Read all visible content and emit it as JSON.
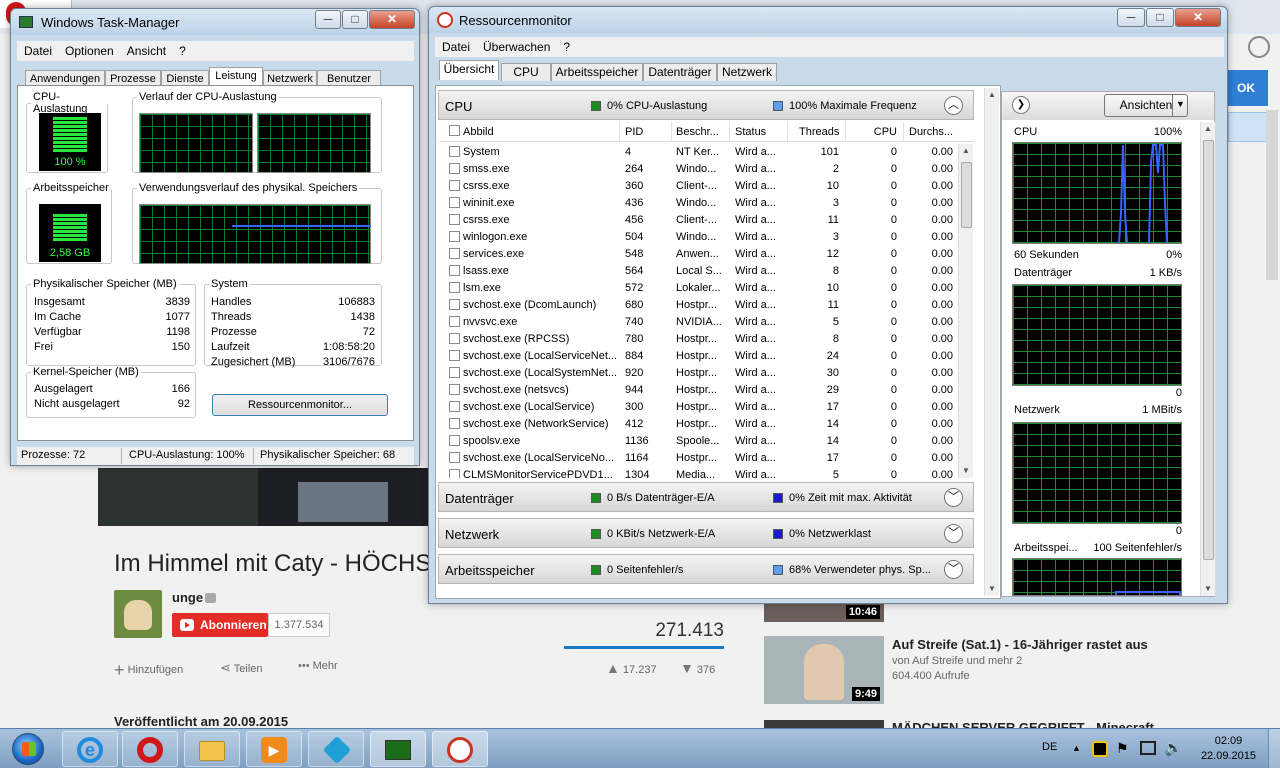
{
  "background": {
    "browser_tab": "Opera",
    "blue_button": "OK",
    "video_title": "Im Himmel mit Caty - HÖCHST",
    "channel": "unge",
    "subscribe": "Abonnieren",
    "subscribers": "1.377.534",
    "views": "271.413",
    "add": "Hinzufügen",
    "share": "Teilen",
    "more": "Mehr",
    "likes": "17.237",
    "dislikes": "376",
    "published": "Veröffentlicht am 20.09.2015",
    "related": [
      {
        "duration": "10:46"
      },
      {
        "title": "Auf Streife (Sat.1) - 16-Jähriger rastet aus",
        "channel": "von Auf Streife und mehr 2",
        "views": "604.400 Aufrufe",
        "duration": "9:49"
      },
      {
        "title": "MÄDCHEN SERVER GEGRIFFT - Minecraft"
      }
    ]
  },
  "taskmgr": {
    "title": "Windows Task-Manager",
    "menu": [
      "Datei",
      "Optionen",
      "Ansicht",
      "?"
    ],
    "tabs": [
      "Anwendungen",
      "Prozesse",
      "Dienste",
      "Leistung",
      "Netzwerk",
      "Benutzer"
    ],
    "cpu_label": "CPU-Auslastung",
    "cpu_value": "100 %",
    "cpu_history_label": "Verlauf der CPU-Auslastung",
    "mem_label": "Arbeitsspeicher",
    "mem_value": "2,58 GB",
    "mem_history_label": "Verwendungsverlauf des physikal. Speichers",
    "physical": {
      "title": "Physikalischer Speicher (MB)",
      "rows": [
        [
          "Insgesamt",
          "3839"
        ],
        [
          "Im Cache",
          "1077"
        ],
        [
          "Verfügbar",
          "1198"
        ],
        [
          "Frei",
          "150"
        ]
      ]
    },
    "system": {
      "title": "System",
      "rows": [
        [
          "Handles",
          "106883"
        ],
        [
          "Threads",
          "1438"
        ],
        [
          "Prozesse",
          "72"
        ],
        [
          "Laufzeit",
          "1:08:58:20"
        ],
        [
          "Zugesichert (MB)",
          "3106/7676"
        ]
      ]
    },
    "kernel": {
      "title": "Kernel-Speicher (MB)",
      "rows": [
        [
          "Ausgelagert",
          "166"
        ],
        [
          "Nicht ausgelagert",
          "92"
        ]
      ]
    },
    "resmon_button": "Ressourcenmonitor...",
    "status": [
      "Prozesse: 72",
      "CPU-Auslastung: 100%",
      "Physikalischer Speicher: 68"
    ]
  },
  "resmon": {
    "title": "Ressourcenmonitor",
    "menu": [
      "Datei",
      "Überwachen",
      "?"
    ],
    "tabs": [
      "Übersicht",
      "CPU",
      "Arbeitsspeicher",
      "Datenträger",
      "Netzwerk"
    ],
    "cpu_section": {
      "name": "CPU",
      "stat1": "0% CPU-Auslastung",
      "stat2": "100% Maximale Frequenz"
    },
    "columns": [
      "Abbild",
      "PID",
      "Beschr...",
      "Status",
      "Threads",
      "CPU",
      "Durchs..."
    ],
    "processes": [
      [
        "System",
        "4",
        "NT Ker...",
        "Wird a...",
        "101",
        "0",
        "0.00"
      ],
      [
        "smss.exe",
        "264",
        "Windo...",
        "Wird a...",
        "2",
        "0",
        "0.00"
      ],
      [
        "csrss.exe",
        "360",
        "Client-...",
        "Wird a...",
        "10",
        "0",
        "0.00"
      ],
      [
        "wininit.exe",
        "436",
        "Windo...",
        "Wird a...",
        "3",
        "0",
        "0.00"
      ],
      [
        "csrss.exe",
        "456",
        "Client-...",
        "Wird a...",
        "11",
        "0",
        "0.00"
      ],
      [
        "winlogon.exe",
        "504",
        "Windo...",
        "Wird a...",
        "3",
        "0",
        "0.00"
      ],
      [
        "services.exe",
        "548",
        "Anwen...",
        "Wird a...",
        "12",
        "0",
        "0.00"
      ],
      [
        "lsass.exe",
        "564",
        "Local S...",
        "Wird a...",
        "8",
        "0",
        "0.00"
      ],
      [
        "lsm.exe",
        "572",
        "Lokaler...",
        "Wird a...",
        "10",
        "0",
        "0.00"
      ],
      [
        "svchost.exe (DcomLaunch)",
        "680",
        "Hostpr...",
        "Wird a...",
        "11",
        "0",
        "0.00"
      ],
      [
        "nvvsvc.exe",
        "740",
        "NVIDIA...",
        "Wird a...",
        "5",
        "0",
        "0.00"
      ],
      [
        "svchost.exe (RPCSS)",
        "780",
        "Hostpr...",
        "Wird a...",
        "8",
        "0",
        "0.00"
      ],
      [
        "svchost.exe (LocalServiceNet...",
        "884",
        "Hostpr...",
        "Wird a...",
        "24",
        "0",
        "0.00"
      ],
      [
        "svchost.exe (LocalSystemNet...",
        "920",
        "Hostpr...",
        "Wird a...",
        "30",
        "0",
        "0.00"
      ],
      [
        "svchost.exe (netsvcs)",
        "944",
        "Hostpr...",
        "Wird a...",
        "29",
        "0",
        "0.00"
      ],
      [
        "svchost.exe (LocalService)",
        "300",
        "Hostpr...",
        "Wird a...",
        "17",
        "0",
        "0.00"
      ],
      [
        "svchost.exe (NetworkService)",
        "412",
        "Hostpr...",
        "Wird a...",
        "14",
        "0",
        "0.00"
      ],
      [
        "spoolsv.exe",
        "1136",
        "Spoole...",
        "Wird a...",
        "14",
        "0",
        "0.00"
      ],
      [
        "svchost.exe (LocalServiceNo...",
        "1164",
        "Hostpr...",
        "Wird a...",
        "17",
        "0",
        "0.00"
      ],
      [
        "CLMSMonitorServicePDVD1...",
        "1304",
        "Media...",
        "Wird a...",
        "5",
        "0",
        "0.00"
      ]
    ],
    "disk_section": {
      "name": "Datenträger",
      "stat1": "0 B/s Datenträger-E/A",
      "stat2": "0% Zeit mit max. Aktivität"
    },
    "net_section": {
      "name": "Netzwerk",
      "stat1": "0 KBit/s Netzwerk-E/A",
      "stat2": "0% Netzwerklast"
    },
    "mem_section": {
      "name": "Arbeitsspeicher",
      "stat1": "0 Seitenfehler/s",
      "stat2": "68% Verwendeter phys. Sp..."
    },
    "side": {
      "view_button": "Ansichten",
      "cpu": {
        "label": "CPU",
        "max": "100%",
        "footer_left": "60 Sekunden",
        "footer_right": "0%"
      },
      "disk": {
        "label": "Datenträger",
        "max": "1 KB/s",
        "min": "0"
      },
      "net": {
        "label": "Netzwerk",
        "max": "1 MBit/s",
        "min": "0"
      },
      "mem": {
        "label": "Arbeitsspei...",
        "max": "100 Seitenfehler/s"
      }
    }
  },
  "taskbar": {
    "lang": "DE",
    "time": "02:09",
    "date": "22.09.2015"
  },
  "colors": {
    "graph_green": "#27e83a",
    "graph_line_blue": "#3a62ff",
    "accent_blue": "#1a1acb"
  }
}
